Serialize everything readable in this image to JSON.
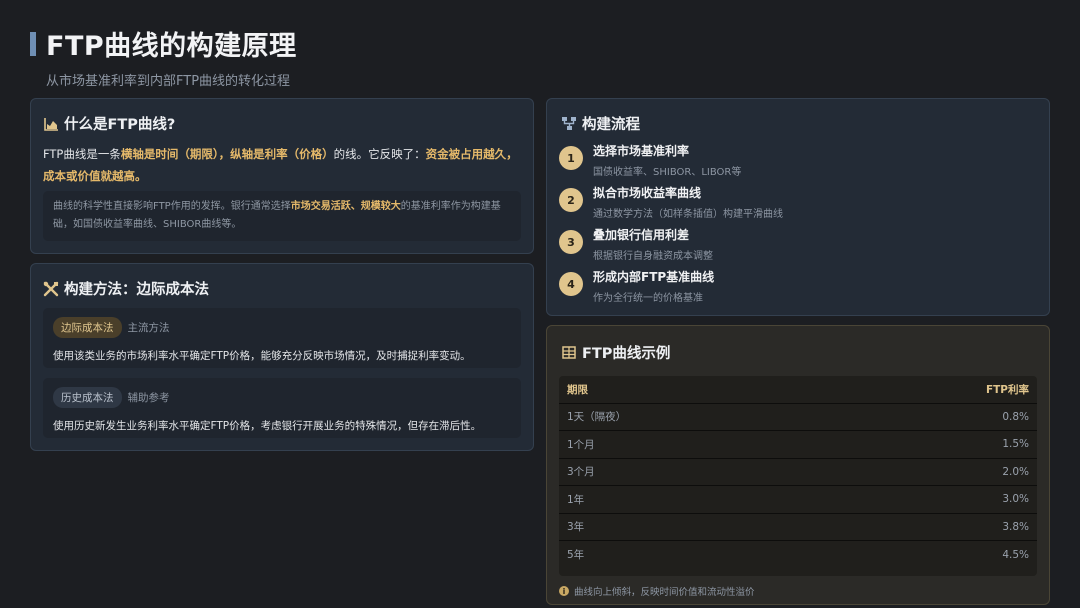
{
  "header": {
    "title": "FTP曲线的构建原理",
    "subtitle": "从市场基准利率到内部FTP曲线的转化过程"
  },
  "what_card": {
    "title": "什么是FTP曲线?",
    "p_pre": "FTP曲线是一条",
    "p_hl1": "横轴是时间（期限），纵轴是利率（价格）",
    "p_mid": "的线。它反映了：",
    "p_hl2": "资金被占用越久，成本或价值就越高。",
    "note_pre": "曲线的科学性直接影响FTP作用的发挥。银行通常选择",
    "note_hl": "市场交易活跃、规模较大",
    "note_post": "的基准利率作为构建基础，如国债收益率曲线、SHIBOR曲线等。"
  },
  "method_card": {
    "title": "构建方法：边际成本法",
    "methods": [
      {
        "tag": "边际成本法",
        "tag_note": "主流方法",
        "desc": "使用该类业务的市场利率水平确定FTP价格，能够充分反映市场情况，及时捕捉利率变动。"
      },
      {
        "tag": "历史成本法",
        "tag_note": "辅助参考",
        "desc": "使用历史新发生业务利率水平确定FTP价格，考虑银行开展业务的特殊情况，但存在滞后性。"
      }
    ]
  },
  "process_card": {
    "title": "构建流程",
    "steps": [
      {
        "num": "1",
        "title": "选择市场基准利率",
        "desc": "国债收益率、SHIBOR、LIBOR等"
      },
      {
        "num": "2",
        "title": "拟合市场收益率曲线",
        "desc": "通过数学方法（如样条插值）构建平滑曲线"
      },
      {
        "num": "3",
        "title": "叠加银行信用利差",
        "desc": "根据银行自身融资成本调整"
      },
      {
        "num": "4",
        "title": "形成内部FTP基准曲线",
        "desc": "作为全行统一的价格基准"
      }
    ]
  },
  "example_card": {
    "title": "FTP曲线示例",
    "col_term": "期限",
    "col_rate": "FTP利率",
    "rows": [
      {
        "term": "1天（隔夜）",
        "rate": "0.8%"
      },
      {
        "term": "1个月",
        "rate": "1.5%"
      },
      {
        "term": "3个月",
        "rate": "2.0%"
      },
      {
        "term": "1年",
        "rate": "3.0%"
      },
      {
        "term": "3年",
        "rate": "3.8%"
      },
      {
        "term": "5年",
        "rate": "4.5%"
      }
    ],
    "footnote": "曲线向上倾斜，反映时间价值和流动性溢价"
  },
  "icons": {
    "what": "chart-area-icon",
    "method": "tools-icon",
    "process": "sitemap-icon",
    "example": "table-icon",
    "footnote": "info-icon"
  },
  "colors": {
    "accent": "#e0c58d",
    "highlight": "#e5b96a",
    "title_bar": "#6f8fb4",
    "background": "#1c1e22"
  }
}
